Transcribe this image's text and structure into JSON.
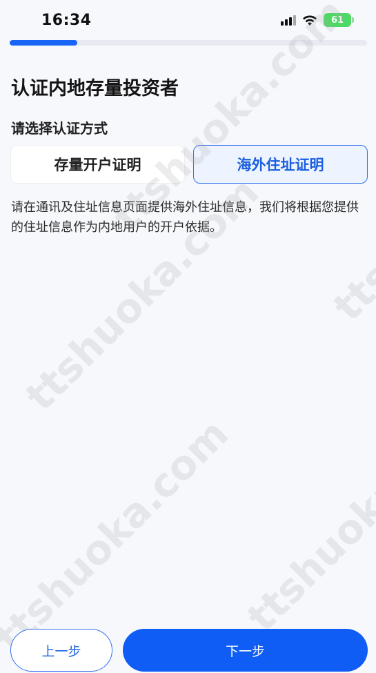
{
  "status_bar": {
    "time": "16:34",
    "battery_level": "61",
    "battery_color": "#4cd964"
  },
  "progress": {
    "fraction": 0.19,
    "color": "#1764f5"
  },
  "page": {
    "title": "认证内地存量投资者",
    "section_label": "请选择认证方式",
    "options": [
      {
        "label": "存量开户证明",
        "selected": false
      },
      {
        "label": "海外住址证明",
        "selected": true
      }
    ],
    "description": "请在通讯及住址信息页面提供海外住址信息，我们将根据您提供的住址信息作为内地用户的开户依据。"
  },
  "watermark": {
    "text": "ttshuoka.com"
  },
  "actions": {
    "prev_label": "上一步",
    "next_label": "下一步"
  },
  "colors": {
    "accent": "#0f5df5",
    "selected_bg": "#eef4ff"
  }
}
